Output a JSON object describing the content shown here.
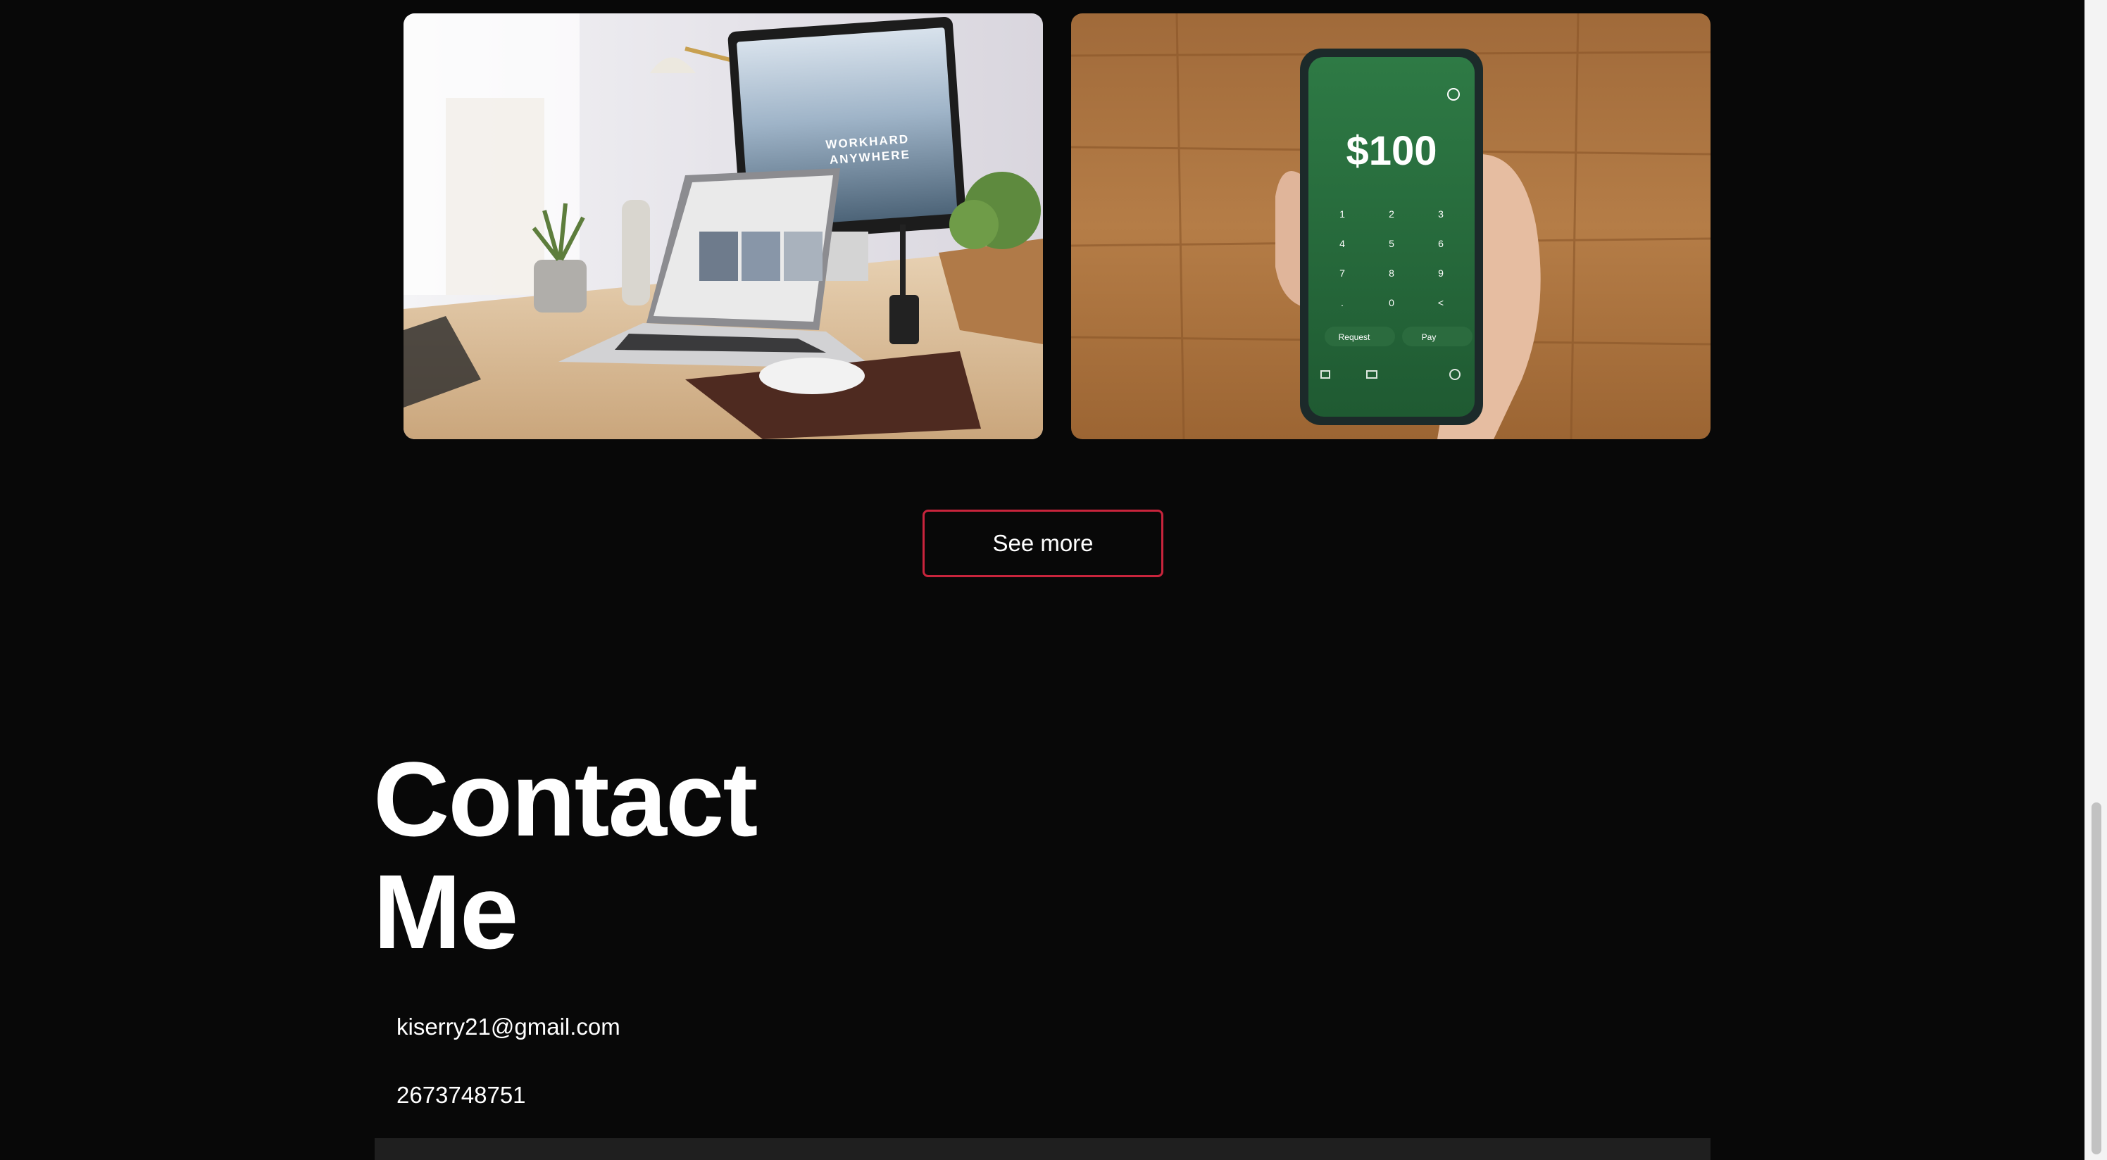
{
  "projects": [
    {
      "id": "desk",
      "monitor_text": [
        "WORKHARD",
        "ANYWHERE"
      ]
    },
    {
      "id": "phone",
      "amount": "$100",
      "keys": [
        "1",
        "2",
        "3",
        "4",
        "5",
        "6",
        "7",
        "8",
        "9",
        ".",
        "0",
        "<"
      ],
      "request_label": "Request",
      "pay_label": "Pay"
    }
  ],
  "see_more_label": "See more",
  "contact": {
    "title_line1": "Contact",
    "title_line2": "Me",
    "email": "kiserry21@gmail.com",
    "phone": "2673748751"
  },
  "colors": {
    "background": "#080808",
    "accent": "#c8243c",
    "text": "#ffffff"
  }
}
